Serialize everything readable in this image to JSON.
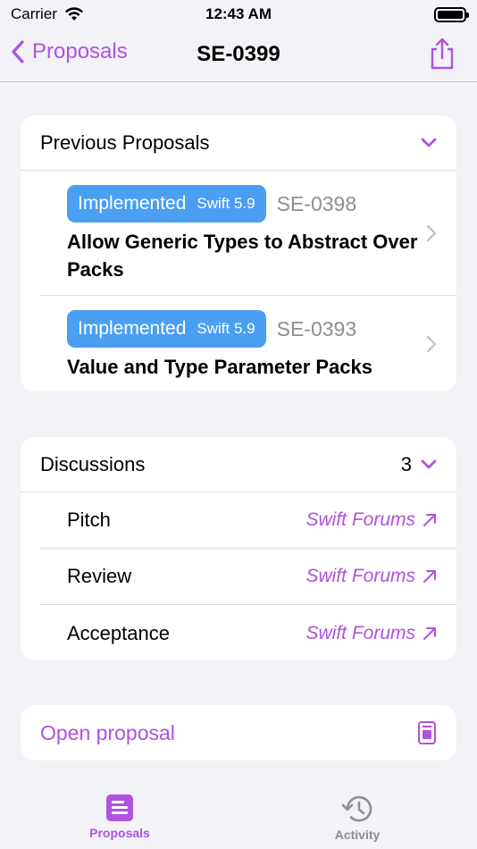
{
  "status": {
    "carrier": "Carrier",
    "time": "12:43 AM"
  },
  "nav": {
    "back_label": "Proposals",
    "title": "SE-0399"
  },
  "previous": {
    "header": "Previous Proposals",
    "items": [
      {
        "status": "Implemented",
        "version": "Swift 5.9",
        "id": "SE-0398",
        "title": "Allow Generic Types to Abstract Over Packs"
      },
      {
        "status": "Implemented",
        "version": "Swift 5.9",
        "id": "SE-0393",
        "title": "Value and Type Parameter Packs"
      }
    ]
  },
  "discussions": {
    "header": "Discussions",
    "count": "3",
    "items": [
      {
        "label": "Pitch",
        "link": "Swift Forums"
      },
      {
        "label": "Review",
        "link": "Swift Forums"
      },
      {
        "label": "Acceptance",
        "link": "Swift Forums"
      }
    ]
  },
  "open": {
    "label": "Open proposal"
  },
  "tabs": [
    {
      "label": "Proposals",
      "icon": "proposals-icon",
      "selected": true
    },
    {
      "label": "Activity",
      "icon": "history-icon",
      "selected": false
    }
  ],
  "colors": {
    "accent": "#af52de",
    "badge": "#4a9ff2",
    "background": "#f2f2f7",
    "inactive": "#8e8e93"
  }
}
